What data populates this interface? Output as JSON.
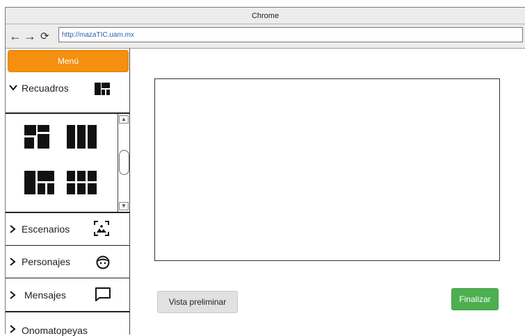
{
  "browser": {
    "title": "Chrome",
    "url": "http://mazaTIC.uam.mx",
    "back_icon": "arrow-left-icon",
    "forward_icon": "arrow-right-icon",
    "reload_icon": "reload-icon"
  },
  "sidebar": {
    "menu_label": "Menú",
    "sections": [
      {
        "label": "Recuadros",
        "expanded": true,
        "icon": "layout-grid-icon"
      },
      {
        "label": "Escenarios",
        "expanded": false,
        "icon": "landscape-image-icon"
      },
      {
        "label": "Personajes",
        "expanded": false,
        "icon": "face-icon"
      },
      {
        "label": "Mensajes",
        "expanded": false,
        "icon": "speech-bubble-icon"
      },
      {
        "label": "Onomatopeyas",
        "expanded": false,
        "icon": ""
      }
    ],
    "layout_thumbs": [
      "layout-2x2-icon",
      "layout-3col-icon",
      "layout-big-left-icon",
      "layout-3x2-icon"
    ]
  },
  "main": {
    "preview_button": "Vista preliminar",
    "finish_button": "Finalizar"
  },
  "colors": {
    "menu_accent": "#f48f10",
    "finish_green": "#4caf50",
    "url_blue": "#2a5db0"
  }
}
